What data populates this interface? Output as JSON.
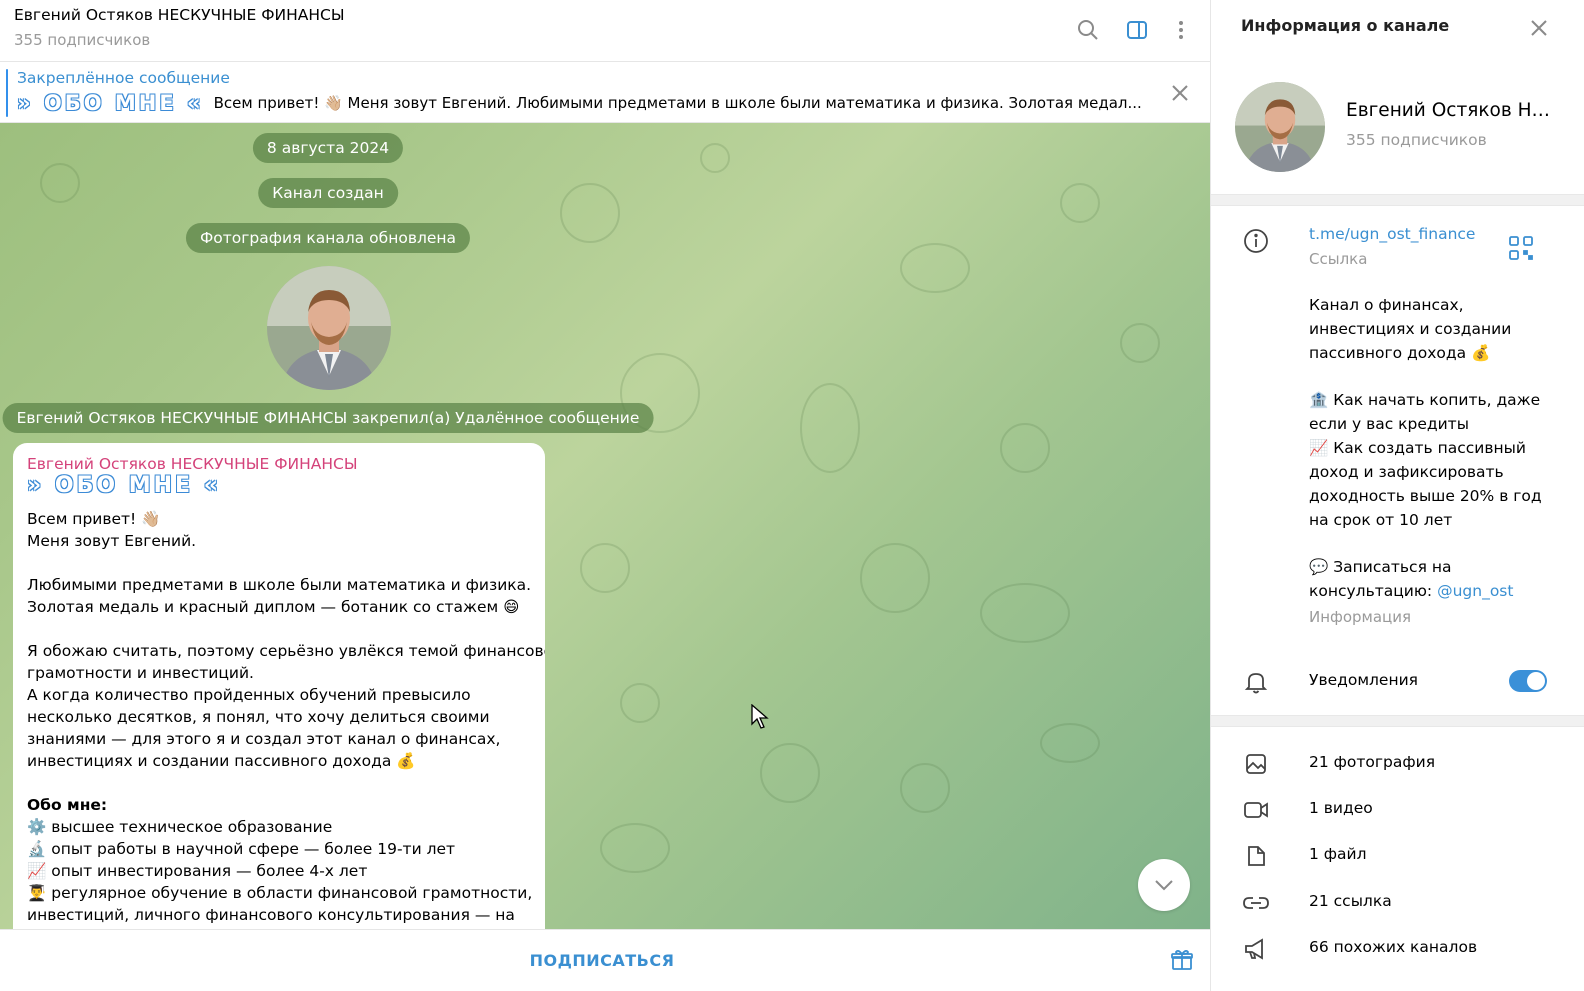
{
  "header": {
    "title": "Евгений Остяков НЕСКУЧНЫЕ ФИНАНСЫ",
    "subtitle": "355 подписчиков",
    "icons": [
      "search-icon",
      "sidebar-toggle-icon",
      "more-vertical-icon"
    ]
  },
  "pinned": {
    "title": "Закреплённое сообщение",
    "fancy": "» ОБО МНЕ «",
    "text": "Всем привет! 👋🏼 Меня зовут Евгений.  Любимыми предметами в школе были математика и физика. Золотая медал..."
  },
  "service": {
    "date": "8 августа 2024",
    "created": "Канал создан",
    "photo_updated": "Фотография канала обновлена",
    "pinned_deleted": "Евгений Остяков НЕСКУЧНЫЕ ФИНАНСЫ закрепил(а) Удалённое сообщение"
  },
  "message": {
    "author": "Евгений Остяков НЕСКУЧНЫЕ ФИНАНСЫ",
    "fancy": "» ОБО МНЕ «",
    "l1": "Всем привет! 👋🏼",
    "l2": "Меня зовут Евгений.",
    "l3": "Любимыми предметами в школе были математика и физика.",
    "l4": "Золотая медаль и красный диплом — ботаник со стажем 😄",
    "l5": "Я обожаю считать, поэтому серьёзно увлёкся темой финансовой",
    "l6": "грамотности и инвестиций.",
    "l7": "А когда количество пройденных обучений превысило",
    "l8": "несколько десятков, я понял, что хочу делиться своими",
    "l9": "знаниями — для этого я и создал этот канал о финансах,",
    "l10": "инвестициях и создании пассивного дохода 💰",
    "about": "Обо мне:",
    "b1": "⚙️ высшее техническое образование",
    "b2": "🔬 опыт работы в научной сфере — более 19-ти лет",
    "b3": "📈 опыт инвестирования — более 4-х лет",
    "b4": "👨‍🎓 регулярное обучение в области финансовой грамотности,",
    "b5": "инвестиций, личного финансового консультирования — на"
  },
  "footer": {
    "subscribe": "ПОДПИСАТЬСЯ"
  },
  "panel": {
    "title": "Информация о канале",
    "name": "Евгений Остяков НЕСКУЧНЫЕ ФИНАНСЫ",
    "subs": "355 подписчиков",
    "link": "t.me/ugn_ost_finance",
    "link_label": "Ссылка",
    "d1": "Канал о финансах,",
    "d2": "инвестициях и создании",
    "d3": "пассивного дохода 💰",
    "d4": "🏦 Как начать копить, даже",
    "d5": "если у вас кредиты",
    "d6": "📈 Как создать пассивный",
    "d7": "доход и зафиксировать",
    "d8": "доходность выше 20% в год",
    "d9": "на срок от 10 лет",
    "d10": "💬 Записаться на",
    "d11_prefix": "консультацию: ",
    "d11_link": "@ugn_ost",
    "desc_label": "Информация",
    "notifications": "Уведомления",
    "notifications_on": true,
    "media": {
      "photos": "21 фотография",
      "videos": "1 видео",
      "files": "1 файл",
      "links": "21 ссылка",
      "similar": "66 похожих каналов"
    }
  },
  "colors": {
    "accent": "#3a8fd1",
    "author": "#d4427a",
    "service_bg": "#5a8246"
  }
}
